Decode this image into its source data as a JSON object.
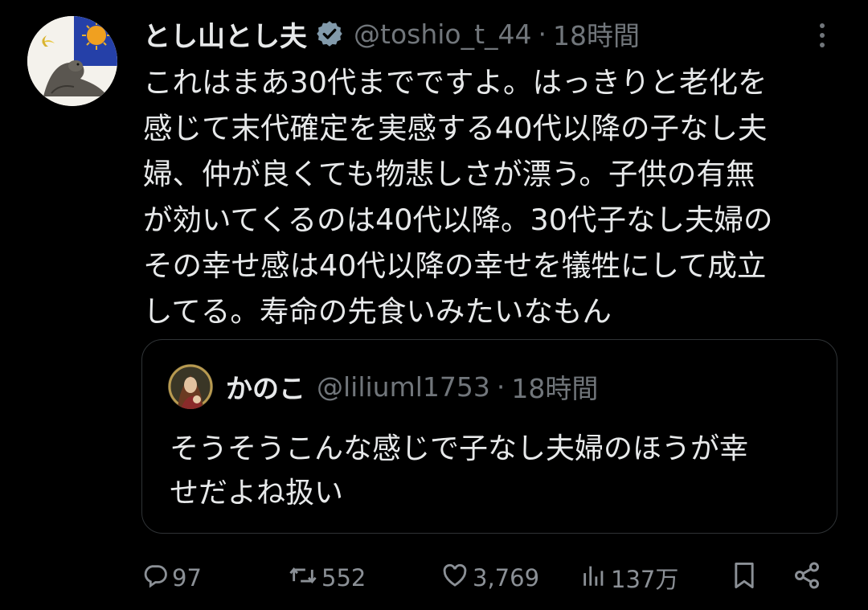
{
  "tweet": {
    "display_name": "とし山とし夫",
    "handle": "@toshio_t_44",
    "separator": "·",
    "time": "18時間",
    "text": "これはまあ30代までですよ。はっきりと老化を\n感じて末代確定を実感する40代以降の子なし夫\n婦、仲が良くても物悲しさが漂う。子供の有無\nが効いてくるのは40代以降。30代子なし夫婦の\nその幸せ感は40代以降の幸せを犠牲にして成立\nしてる。寿命の先食いみたいなもん",
    "verified_icon": "verified-badge-icon",
    "more_icon": "more-vertical-icon"
  },
  "quote": {
    "display_name": "かのこ",
    "handle": "@liliuml1753",
    "separator": "·",
    "time": "18時間",
    "text": "そうそうこんな感じで子なし夫婦のほうが幸\nせだよね扱い"
  },
  "actions": {
    "replies": "97",
    "retweets": "552",
    "likes": "3,769",
    "views": "137万",
    "icons": [
      "reply-icon",
      "retweet-icon",
      "like-icon",
      "views-icon",
      "bookmark-icon",
      "share-icon"
    ]
  },
  "colors": {
    "background": "#000000",
    "text": "#e7e9ea",
    "secondary": "#71767b",
    "border": "#2f3336",
    "verified": "#829aab"
  }
}
